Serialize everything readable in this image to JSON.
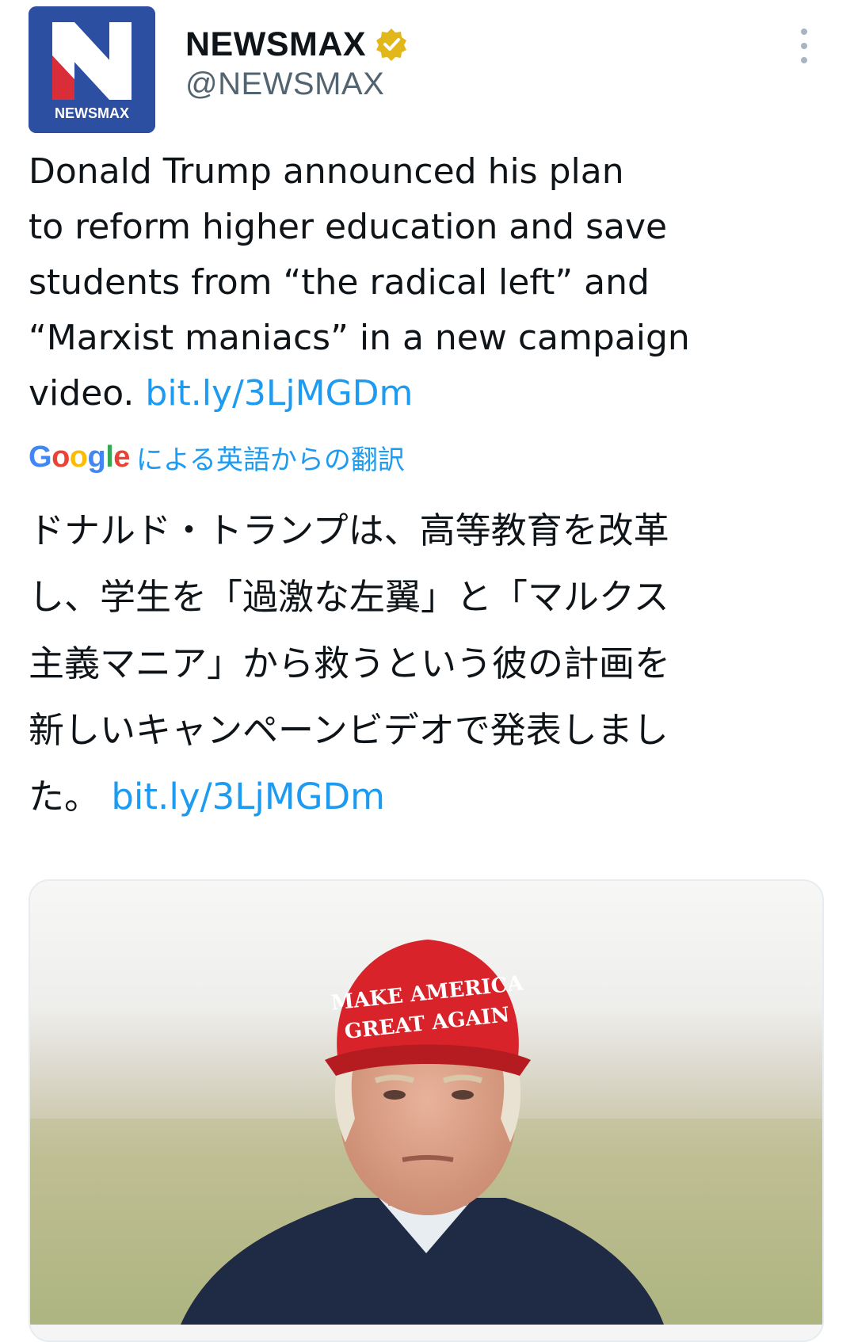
{
  "author": {
    "display_name": "NEWSMAX",
    "handle": "@NEWSMAX",
    "avatar_letter": "N",
    "avatar_caption": "NEWSMAX",
    "verified": true,
    "verified_color": "#e2b719",
    "avatar_color": "#2d4fa1"
  },
  "tweet": {
    "text_lines": [
      "Donald Trump announced his plan",
      "to reform higher education and save",
      "students from “the radical left” and",
      "“Marxist maniacs” in a new campaign"
    ],
    "last_line_prefix": "video. ",
    "link": "bit.ly/3LjMGDm",
    "link_color": "#1d9bf0"
  },
  "translation": {
    "provider": "Google",
    "label": "による英語からの翻訳",
    "text_lines": [
      "ドナルド・トランプは、高等教育を改革",
      "し、学生を「過激な左翼」と「マルクス",
      "主義マニア」から救うという彼の計画を",
      "新しいキャンペーンビデオで発表しまし"
    ],
    "last_line_prefix": "た。 ",
    "link": "bit.ly/3LjMGDm"
  },
  "media": {
    "cap_line1": "MAKE AMERICA",
    "cap_line2": "GREAT AGAIN",
    "icons": [
      "more-vertical-icon",
      "verified-badge-icon",
      "newsmax-logo"
    ]
  }
}
